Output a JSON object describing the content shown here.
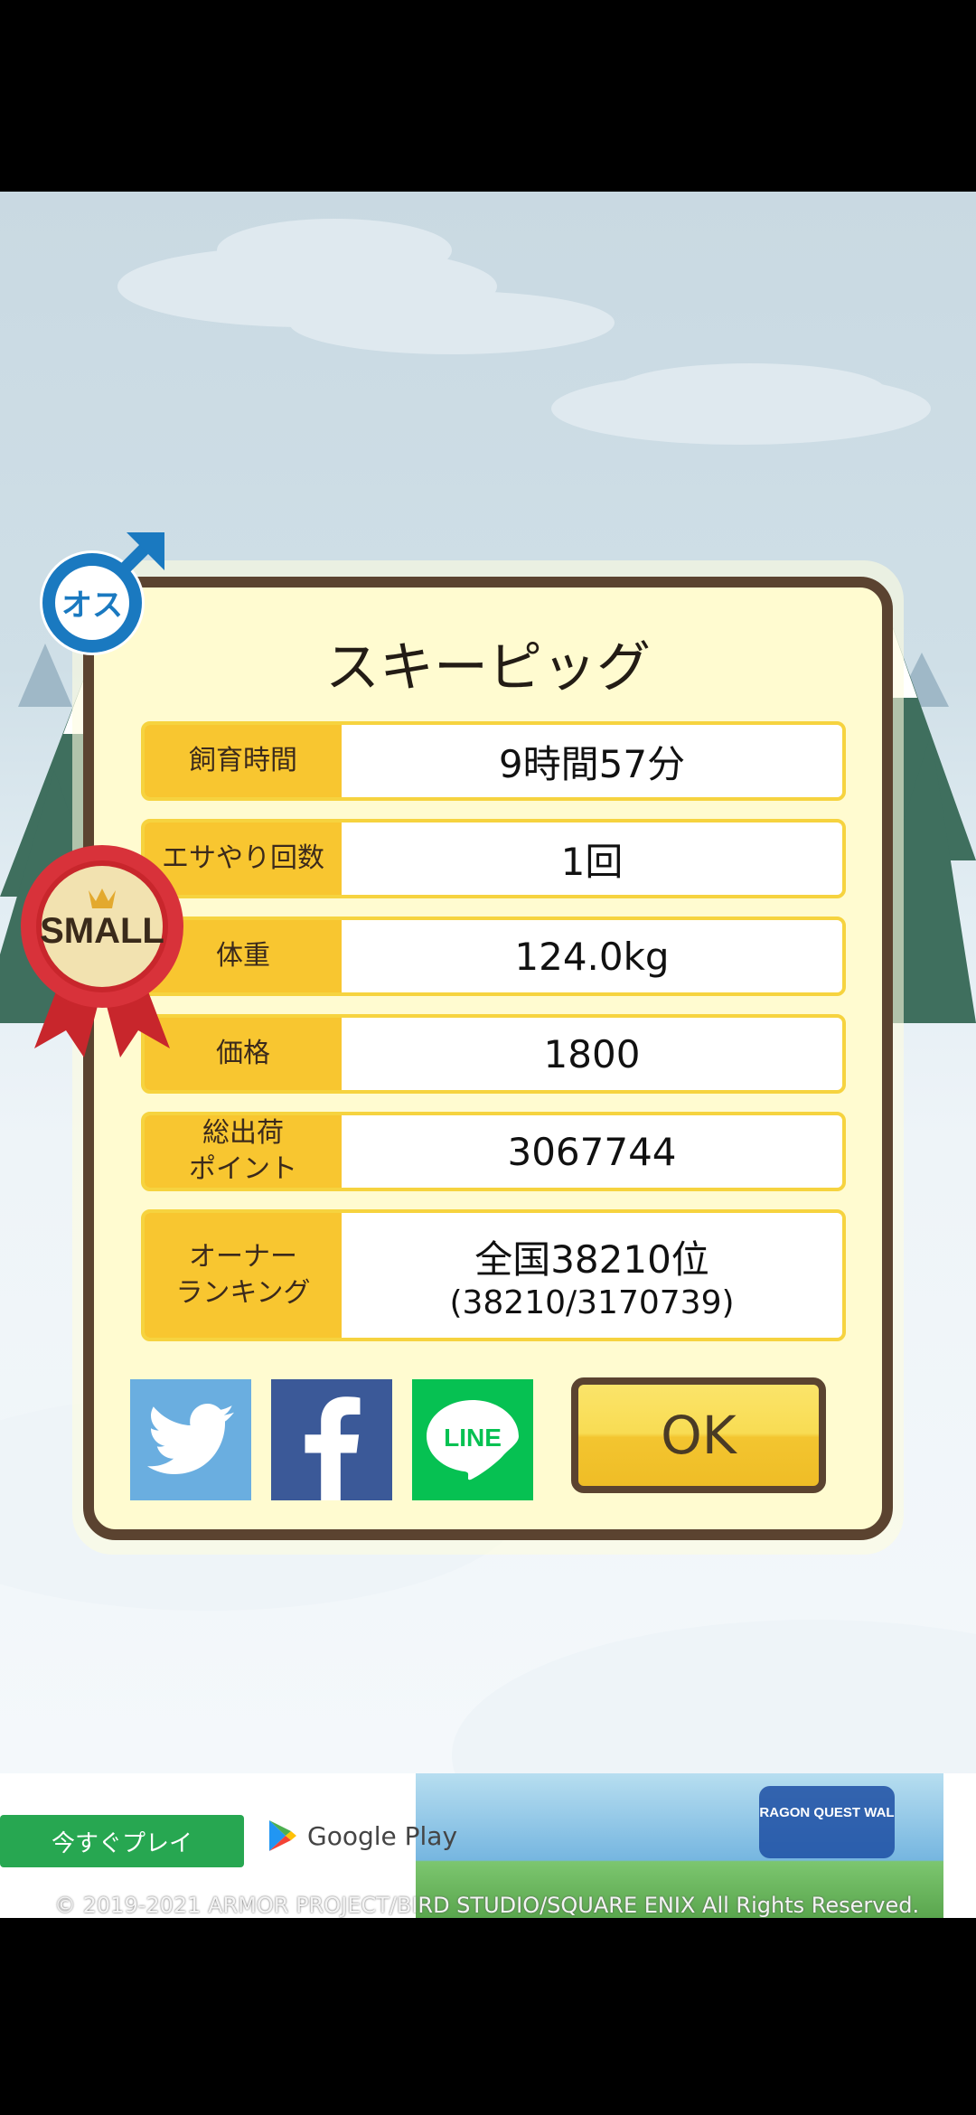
{
  "pet_name": "スキーピッグ",
  "gender_badge": "オス",
  "size_badge": "SMALL",
  "stats": [
    {
      "label": "飼育時間",
      "value": "9時間57分"
    },
    {
      "label": "エサやり回数",
      "value": "1回"
    },
    {
      "label": "体重",
      "value": "124.0kg"
    },
    {
      "label": "価格",
      "value": "1800"
    },
    {
      "label": "総出荷\nポイント",
      "value": "3067744"
    }
  ],
  "ranking": {
    "label": "オーナー\nランキング",
    "value": "全国38210位",
    "detail": "(38210/3170739)"
  },
  "share": {
    "twitter": "twitter-icon",
    "facebook": "facebook-icon",
    "line_label": "LINE"
  },
  "ok_label": "OK",
  "ad": {
    "play_now": "今すぐプレイ",
    "store": "Google Play",
    "game_logo": "DRAGON QUEST WALK",
    "copyright": "© 2019-2021 ARMOR PROJECT/BIRD STUDIO/SQUARE ENIX All Rights Reserved."
  },
  "colors": {
    "panel_border": "#5b4330",
    "panel_bg": "#fffbd0",
    "label_bg": "#f8c630",
    "ok_bg": "#f8dc53",
    "twitter": "#6aaee0",
    "facebook": "#3b5998",
    "line": "#06c152"
  }
}
